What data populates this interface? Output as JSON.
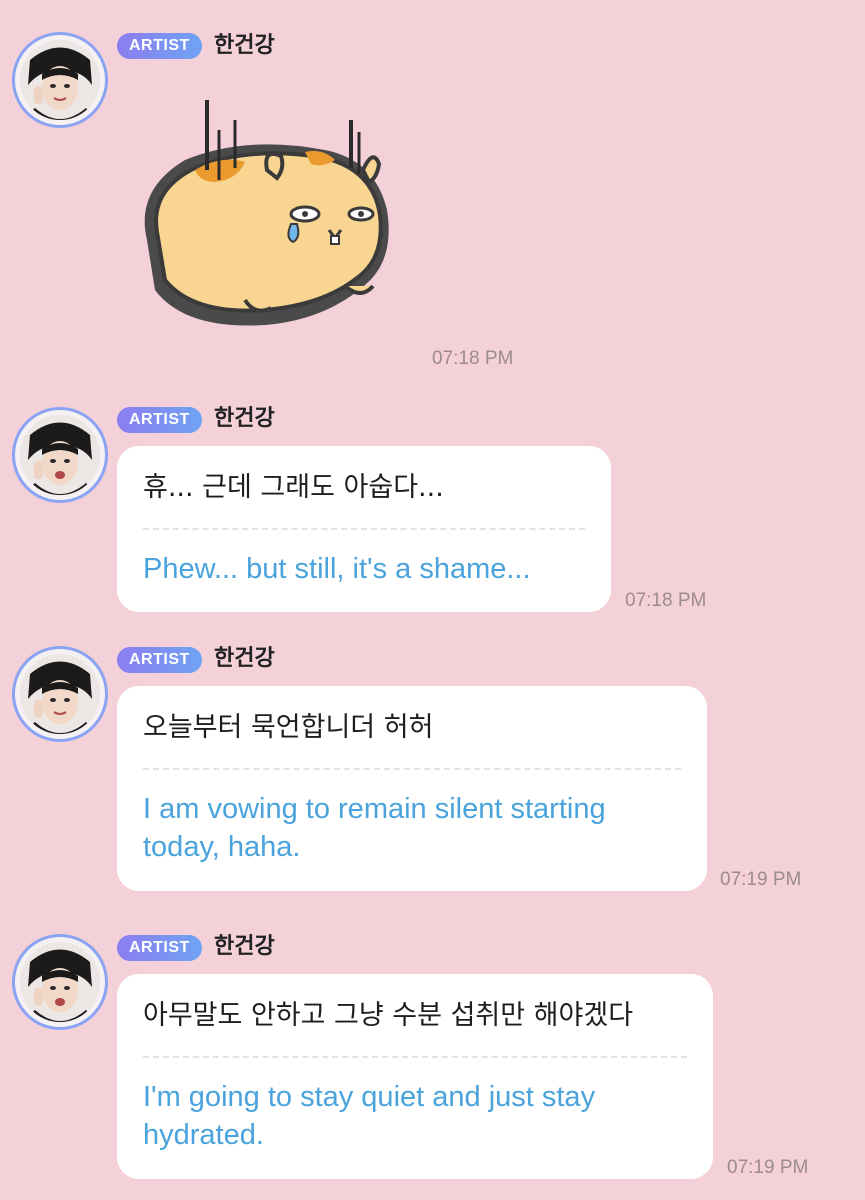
{
  "sender": {
    "badge": "ARTIST",
    "name": "한건강"
  },
  "messages": [
    {
      "type": "sticker",
      "sticker_name": "crying-hamster-sticker",
      "time": "07:18 PM"
    },
    {
      "type": "text",
      "original": "휴... 근데 그래도 아숩다...",
      "translation": "Phew... but still, it's a shame...",
      "time": "07:18 PM"
    },
    {
      "type": "text",
      "original": "오늘부터 묵언합니더 허허",
      "translation": "I am vowing to remain silent starting today, haha.",
      "time": "07:19 PM"
    },
    {
      "type": "text",
      "original": "아무말도 안하고 그냥 수분 섭취만 해야겠다",
      "translation": "I'm going to stay quiet and just stay hydrated.",
      "time": "07:19 PM"
    }
  ],
  "colors": {
    "background": "#f4d1d9",
    "translation": "#4aa3dc",
    "avatar_ring": "#8aa3f2",
    "badge_gradient_start": "#8c7df0",
    "badge_gradient_end": "#6fa3f3"
  }
}
